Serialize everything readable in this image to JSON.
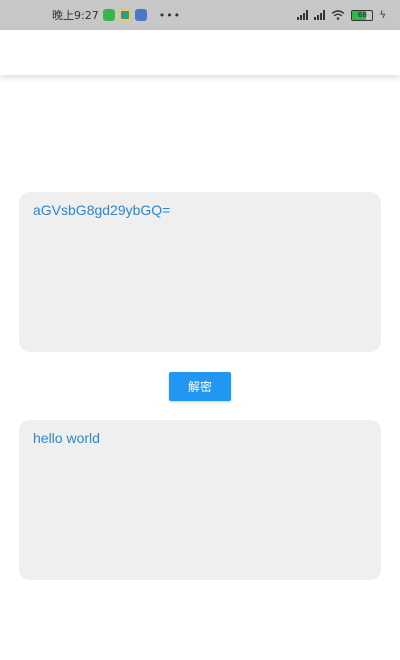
{
  "status_bar": {
    "time": "晚上9:27",
    "more": "•••",
    "battery_level": "68",
    "icons": [
      "wechat-icon",
      "app-icon",
      "browser-icon",
      "signal-icon",
      "signal-icon",
      "wifi-icon",
      "battery-icon",
      "charging-icon"
    ]
  },
  "input": {
    "value": "aGVsbG8gd29ybGQ="
  },
  "decrypt_button": {
    "label": "解密"
  },
  "output": {
    "value": "hello world"
  },
  "colors": {
    "accent": "#2296f3",
    "text": "#2f86c9",
    "box_bg": "#efefef"
  }
}
